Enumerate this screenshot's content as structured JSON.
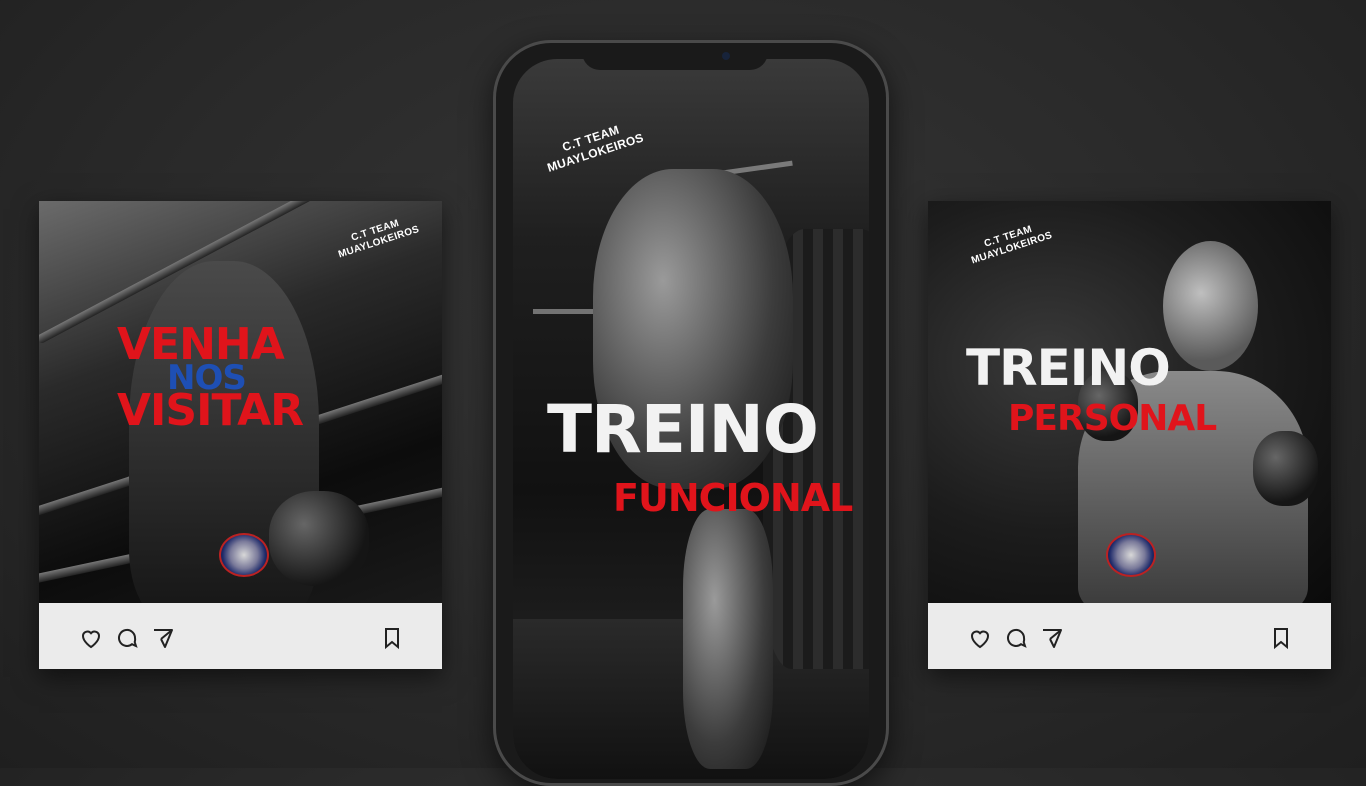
{
  "left_post": {
    "brand_line1": "C.T TEAM",
    "brand_line2": "MUAYLOKEIROS",
    "headline_1": "VENHA",
    "headline_2": "NOS",
    "headline_3": "VISITAR",
    "logo_text_top": "TEAM",
    "logo_text_bottom": "MUAYTHAI"
  },
  "phone_post": {
    "brand_line1": "C.T TEAM",
    "brand_line2": "MUAYLOKEIROS",
    "headline_1": "TREINO",
    "headline_2": "FUNCIONAL"
  },
  "right_post": {
    "brand_line1": "C.T TEAM",
    "brand_line2": "MUAYLOKEIROS",
    "headline_1": "TREINO",
    "headline_2": "PERSONAL",
    "logo_text_top": "TEAM",
    "logo_text_bottom": "MUAYTHAI"
  },
  "icons": [
    "heart-icon",
    "comment-icon",
    "share-icon",
    "bookmark-icon"
  ],
  "colors": {
    "accent_red": "#e0141b",
    "accent_blue": "#1e4fb4",
    "background": "#2b2b2b",
    "action_bar": "#ebebeb"
  }
}
